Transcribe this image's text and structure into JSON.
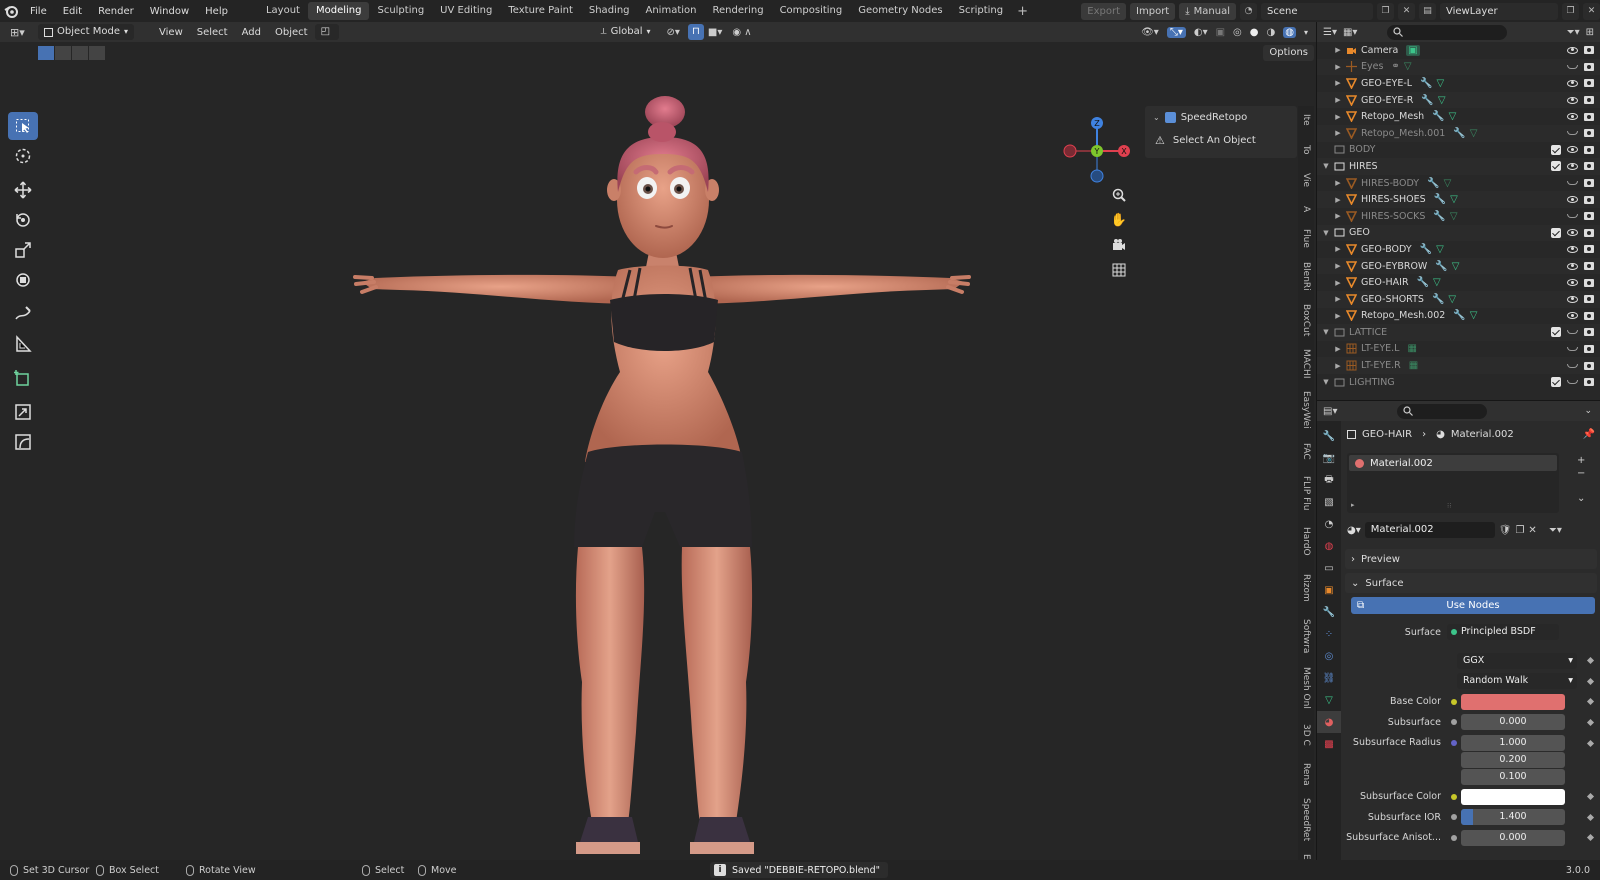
{
  "menubar": {
    "items": [
      "File",
      "Edit",
      "Render",
      "Window",
      "Help"
    ],
    "workspaces": [
      "Layout",
      "Modeling",
      "Sculpting",
      "UV Editing",
      "Texture Paint",
      "Shading",
      "Animation",
      "Rendering",
      "Compositing",
      "Geometry Nodes",
      "Scripting"
    ],
    "active_workspace": "Modeling",
    "add_tab": "+",
    "export": "Export",
    "import": "Import",
    "manual": "Manual",
    "scene": "Scene",
    "view_layer": "ViewLayer"
  },
  "viewport_header": {
    "mode": "Object Mode",
    "menus": [
      "View",
      "Select",
      "Add",
      "Object"
    ],
    "transform_orientation": "Global",
    "options": "Options"
  },
  "npanel": {
    "title": "SpeedRetopo",
    "message": "Select An Object"
  },
  "side_tabs": [
    "Ite",
    "To",
    "Vie",
    "A",
    "Flue",
    "BlenRi",
    "BoxCut",
    "MACHI",
    "EasyWei",
    "FAC",
    "FLIP Flu",
    "HardO",
    "Rizom",
    "Softwra",
    "Mesh Onl",
    "3D C",
    "Rena",
    "SpeedRet",
    "Ed"
  ],
  "outliner": {
    "rows": [
      {
        "label": "Camera",
        "type": "camera",
        "indent": 1,
        "dim": false,
        "check": false,
        "eye": true
      },
      {
        "label": "Eyes",
        "type": "empty",
        "indent": 1,
        "dim": true,
        "check": false,
        "eye": false
      },
      {
        "label": "GEO-EYE-L",
        "type": "mesh",
        "indent": 1,
        "dim": false,
        "check": false,
        "eye": true
      },
      {
        "label": "GEO-EYE-R",
        "type": "mesh",
        "indent": 1,
        "dim": false,
        "check": false,
        "eye": true
      },
      {
        "label": "Retopo_Mesh",
        "type": "mesh",
        "indent": 1,
        "dim": false,
        "check": false,
        "eye": true
      },
      {
        "label": "Retopo_Mesh.001",
        "type": "mesh",
        "indent": 1,
        "dim": true,
        "check": false,
        "eye": false
      },
      {
        "label": "BODY",
        "type": "collection",
        "indent": 0,
        "dim": true,
        "check": true,
        "eye": true
      },
      {
        "label": "HIRES",
        "type": "collection",
        "indent": 0,
        "dim": false,
        "check": true,
        "eye": true
      },
      {
        "label": "HIRES-BODY",
        "type": "mesh",
        "indent": 1,
        "dim": true,
        "check": false,
        "eye": false
      },
      {
        "label": "HIRES-SHOES",
        "type": "mesh",
        "indent": 1,
        "dim": false,
        "check": false,
        "eye": true
      },
      {
        "label": "HIRES-SOCKS",
        "type": "mesh",
        "indent": 1,
        "dim": true,
        "check": false,
        "eye": false
      },
      {
        "label": "GEO",
        "type": "collection",
        "indent": 0,
        "dim": false,
        "check": true,
        "eye": true
      },
      {
        "label": "GEO-BODY",
        "type": "mesh",
        "indent": 1,
        "dim": false,
        "check": false,
        "eye": true
      },
      {
        "label": "GEO-EYBROW",
        "type": "mesh",
        "indent": 1,
        "dim": false,
        "check": false,
        "eye": true
      },
      {
        "label": "GEO-HAIR",
        "type": "mesh",
        "indent": 1,
        "dim": false,
        "check": false,
        "eye": true
      },
      {
        "label": "GEO-SHORTS",
        "type": "mesh",
        "indent": 1,
        "dim": false,
        "check": false,
        "eye": true
      },
      {
        "label": "Retopo_Mesh.002",
        "type": "mesh",
        "indent": 1,
        "dim": false,
        "check": false,
        "eye": true
      },
      {
        "label": "LATTICE",
        "type": "collection",
        "indent": 0,
        "dim": true,
        "check": true,
        "eye": false
      },
      {
        "label": "LT-EYE.L",
        "type": "lattice",
        "indent": 1,
        "dim": true,
        "check": false,
        "eye": false
      },
      {
        "label": "LT-EYE.R",
        "type": "lattice",
        "indent": 1,
        "dim": true,
        "check": false,
        "eye": false
      },
      {
        "label": "LIGHTING",
        "type": "collection",
        "indent": 0,
        "dim": true,
        "check": true,
        "eye": false
      }
    ]
  },
  "properties": {
    "object": "GEO-HAIR",
    "material": "Material.002",
    "slot": "Material.002",
    "material_field": "Material.002",
    "panel_preview": "Preview",
    "panel_surface": "Surface",
    "use_nodes": "Use Nodes",
    "surface_label": "Surface",
    "surface_value": "Principled BSDF",
    "distribution": "GGX",
    "subsurface_method": "Random Walk",
    "base_color_label": "Base Color",
    "base_color": "#e0706f",
    "subsurface_label": "Subsurface",
    "subsurface_value": "0.000",
    "subsurface_radius_label": "Subsurface Radius",
    "subsurface_radius": [
      "1.000",
      "0.200",
      "0.100"
    ],
    "subsurface_color_label": "Subsurface Color",
    "subsurface_color": "#ffffff",
    "subsurface_ior_label": "Subsurface IOR",
    "subsurface_ior_value": "1.400",
    "subsurface_aniso_label": "Subsurface Anisot...",
    "subsurface_aniso_value": "0.000"
  },
  "statusbar": {
    "set_cursor": "Set 3D Cursor",
    "box_select": "Box Select",
    "rotate_view": "Rotate View",
    "select": "Select",
    "move": "Move",
    "saved": "Saved \"DEBBIE-RETOPO.blend\"",
    "version": "3.0.0"
  },
  "colors": {
    "accent": "#4772b3",
    "mesh_icon": "#e8892b",
    "modifier_icon": "#5f8fd6",
    "data_icon": "#3cc48a"
  }
}
